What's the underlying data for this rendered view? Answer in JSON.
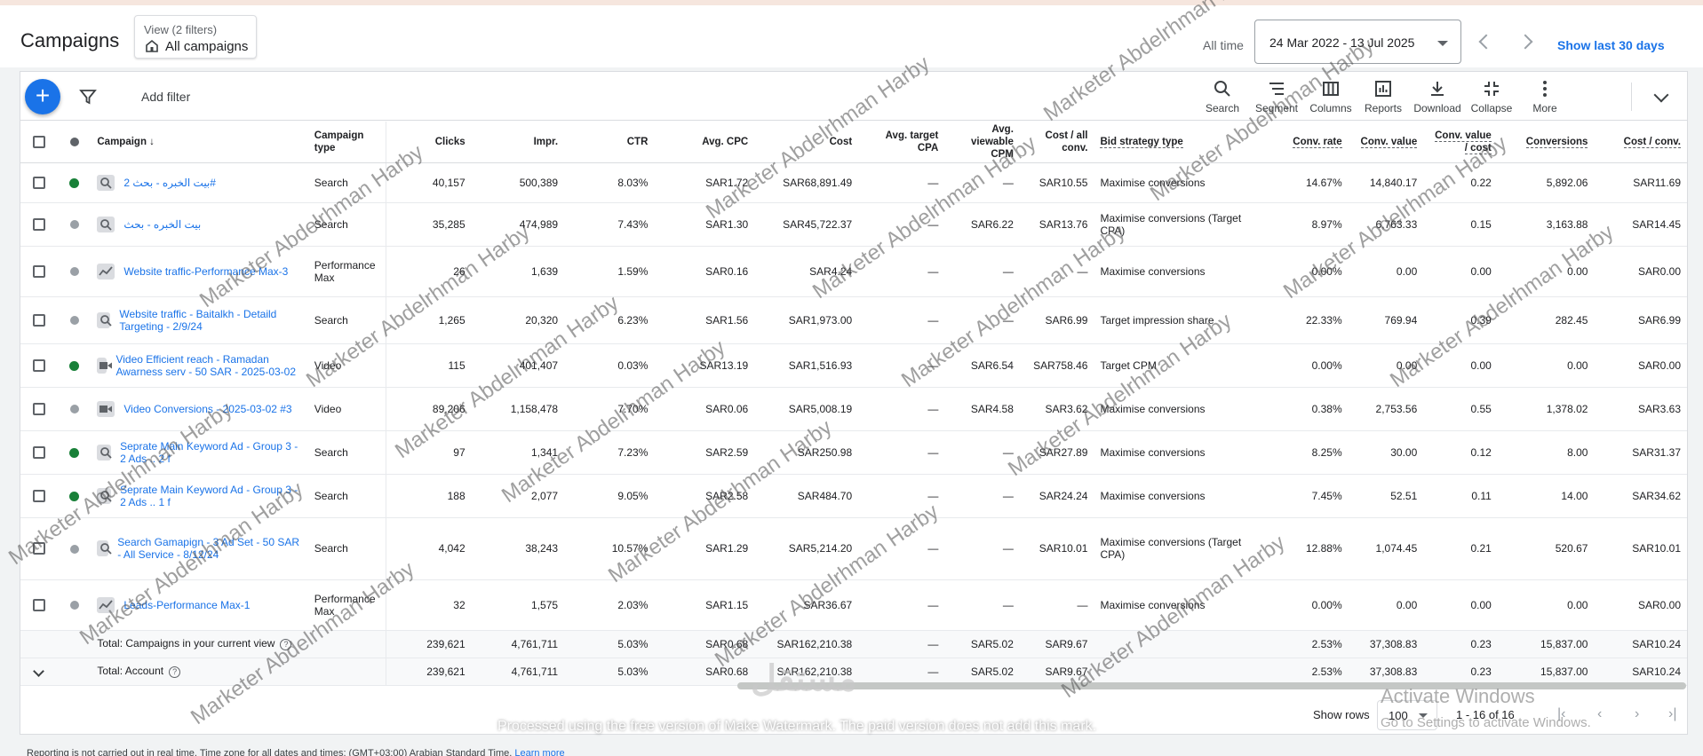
{
  "header": {
    "title": "Campaigns",
    "view_label": "View (2 filters)",
    "view_value": "All campaigns",
    "all_time": "All time",
    "date_range": "24 Mar 2022 - 13 Jul 2025",
    "show_last": "Show last 30 days"
  },
  "toolbar": {
    "add_filter": "Add filter",
    "tools": [
      "Search",
      "Segment",
      "Columns",
      "Reports",
      "Download",
      "Collapse",
      "More"
    ]
  },
  "columns": {
    "campaign": "Campaign",
    "campaign_type": "Campaign type",
    "clicks": "Clicks",
    "impr": "Impr.",
    "ctr": "CTR",
    "avg_cpc": "Avg. CPC",
    "cost": "Cost",
    "avg_target_cpa": "Avg. target CPA",
    "avg_vcpm": "Avg. viewable CPM",
    "cost_conv": "Cost / all conv.",
    "bid": "Bid strategy type",
    "conv_rate": "Conv. rate",
    "conv_value": "Conv. value",
    "conv_value_cost": "Conv. value / cost",
    "conversions": "Conversions",
    "cost_per_conv": "Cost / conv."
  },
  "rows": [
    {
      "status": "enabled",
      "icon": "search",
      "name": "بيت الخبره - بحث 2#",
      "type": "Search",
      "clicks": "40,157",
      "impr": "500,389",
      "ctr": "8.03%",
      "cpc": "SAR1.72",
      "cost": "SAR68,891.49",
      "tcpa": "—",
      "vcpm": "—",
      "costall": "SAR10.55",
      "bid": "Maximise conversions",
      "bid_link": true,
      "crate": "14.67%",
      "cval": "14,840.17",
      "cvc": "0.22",
      "conv": "5,892.06",
      "cpc2": "SAR11.69"
    },
    {
      "status": "paused",
      "icon": "search",
      "name": "بيت الخبره - بحث",
      "type": "Search",
      "clicks": "35,285",
      "impr": "474,989",
      "ctr": "7.43%",
      "cpc": "SAR1.30",
      "cost": "SAR45,722.37",
      "tcpa": "—",
      "vcpm": "SAR6.22",
      "costall": "SAR13.76",
      "bid": "Maximise conversions (Target CPA)",
      "bid_link": true,
      "crate": "8.97%",
      "cval": "6,763.33",
      "cvc": "0.15",
      "conv": "3,163.88",
      "cpc2": "SAR14.45"
    },
    {
      "status": "paused",
      "icon": "pmax",
      "name": "Website traffic-Performance Max-3",
      "type": "Performance Max",
      "clicks": "26",
      "impr": "1,639",
      "ctr": "1.59%",
      "cpc": "SAR0.16",
      "cost": "SAR4.24",
      "tcpa": "—",
      "vcpm": "—",
      "costall": "—",
      "bid": "Maximise conversions",
      "bid_link": true,
      "crate": "0.00%",
      "cval": "0.00",
      "cvc": "0.00",
      "conv": "0.00",
      "cpc2": "SAR0.00"
    },
    {
      "status": "paused",
      "icon": "search",
      "name": "Website traffic - Baitalkh - Detaild Targeting - 2/9/24",
      "type": "Search",
      "clicks": "1,265",
      "impr": "20,320",
      "ctr": "6.23%",
      "cpc": "SAR1.56",
      "cost": "SAR1,973.00",
      "tcpa": "—",
      "vcpm": "—",
      "costall": "SAR6.99",
      "bid": "Target impression share",
      "bid_link": true,
      "crate": "22.33%",
      "cval": "769.94",
      "cvc": "0.39",
      "conv": "282.45",
      "cpc2": "SAR6.99"
    },
    {
      "status": "enabled",
      "icon": "video",
      "name": "Video Efficient reach - Ramadan Awarness serv - 50 SAR - 2025-03-02",
      "type": "Video",
      "clicks": "115",
      "impr": "401,407",
      "ctr": "0.03%",
      "cpc": "SAR13.19",
      "cost": "SAR1,516.93",
      "tcpa": "—",
      "vcpm": "SAR6.54",
      "costall": "SAR758.46",
      "bid": "Target CPM",
      "bid_link": false,
      "crate": "0.00%",
      "cval": "0.00",
      "cvc": "0.00",
      "conv": "0.00",
      "cpc2": "SAR0.00"
    },
    {
      "status": "paused",
      "icon": "video",
      "name": "Video Conversions - 2025-03-02 #3",
      "type": "Video",
      "clicks": "89,206",
      "impr": "1,158,478",
      "ctr": "7.70%",
      "cpc": "SAR0.06",
      "cost": "SAR5,008.19",
      "tcpa": "—",
      "vcpm": "SAR4.58",
      "costall": "SAR3.62",
      "bid": "Maximise conversions",
      "bid_link": true,
      "crate": "0.38%",
      "cval": "2,753.56",
      "cvc": "0.55",
      "conv": "1,378.02",
      "cpc2": "SAR3.63"
    },
    {
      "status": "enabled",
      "icon": "search",
      "name": "Seprate Main Keyword Ad - Group 3 - 2 Ads .. 2 f",
      "type": "Search",
      "clicks": "97",
      "impr": "1,341",
      "ctr": "7.23%",
      "cpc": "SAR2.59",
      "cost": "SAR250.98",
      "tcpa": "—",
      "vcpm": "—",
      "costall": "SAR27.89",
      "bid": "Maximise conversions",
      "bid_link": true,
      "crate": "8.25%",
      "cval": "30.00",
      "cvc": "0.12",
      "conv": "8.00",
      "cpc2": "SAR31.37"
    },
    {
      "status": "enabled",
      "icon": "search",
      "name": "Seprate Main Keyword Ad - Group 3 - 2 Ads .. 1 f",
      "type": "Search",
      "clicks": "188",
      "impr": "2,077",
      "ctr": "9.05%",
      "cpc": "SAR2.58",
      "cost": "SAR484.70",
      "tcpa": "—",
      "vcpm": "—",
      "costall": "SAR24.24",
      "bid": "Maximise conversions",
      "bid_link": true,
      "crate": "7.45%",
      "cval": "52.51",
      "cvc": "0.11",
      "conv": "14.00",
      "cpc2": "SAR34.62"
    },
    {
      "status": "paused",
      "icon": "search",
      "name": "Search Gamapign - 3 Ad Set - 50 SAR - All Service - 8/12/24",
      "type": "Search",
      "clicks": "4,042",
      "impr": "38,243",
      "ctr": "10.57%",
      "cpc": "SAR1.29",
      "cost": "SAR5,214.20",
      "tcpa": "—",
      "vcpm": "—",
      "costall": "SAR10.01",
      "bid": "Maximise conversions (Target CPA)",
      "bid_link": true,
      "crate": "12.88%",
      "cval": "1,074.45",
      "cvc": "0.21",
      "conv": "520.67",
      "cpc2": "SAR10.01"
    },
    {
      "status": "paused",
      "icon": "pmax",
      "name": "Leads-Performance Max-1",
      "type": "Performance Max",
      "clicks": "32",
      "impr": "1,575",
      "ctr": "2.03%",
      "cpc": "SAR1.15",
      "cost": "SAR36.67",
      "tcpa": "—",
      "vcpm": "—",
      "costall": "—",
      "bid": "Maximise conversions",
      "bid_link": true,
      "crate": "0.00%",
      "cval": "0.00",
      "cvc": "0.00",
      "conv": "0.00",
      "cpc2": "SAR0.00"
    }
  ],
  "totals": [
    {
      "label": "Total: Campaigns in your current view",
      "clicks": "239,621",
      "impr": "4,761,711",
      "ctr": "5.03%",
      "cpc": "SAR0.68",
      "cost": "SAR162,210.38",
      "tcpa": "—",
      "vcpm": "SAR5.02",
      "costall": "SAR9.67",
      "crate": "2.53%",
      "cval": "37,308.83",
      "cvc": "0.23",
      "conv": "15,837.00",
      "cpc2": "SAR10.24"
    },
    {
      "label": "Total: Account",
      "clicks": "239,621",
      "impr": "4,761,711",
      "ctr": "5.03%",
      "cpc": "SAR0.68",
      "cost": "SAR162,210.38",
      "tcpa": "—",
      "vcpm": "SAR5.02",
      "costall": "SAR9.67",
      "crate": "2.53%",
      "cval": "37,308.83",
      "cvc": "0.23",
      "conv": "15,837.00",
      "cpc2": "SAR10.24"
    }
  ],
  "pagination": {
    "show_rows": "Show rows",
    "rows_value": "100",
    "range": "1 - 16 of 16"
  },
  "footer": {
    "note": "Reporting is not carried out in real time. Time zone for all dates and times: (GMT+03:00) Arabian Standard Time.",
    "learn_more": "Learn more"
  },
  "overlays": {
    "watermark": "Marketer Abdelrhman Harby",
    "processed": "Processed using the free version of Make Watermark. The paid version does not add this mark.",
    "logo": "مستقل",
    "activate_title": "Activate Windows",
    "activate_sub": "Go to Settings to activate Windows."
  },
  "colors": {
    "accent": "#1a73e8",
    "enabled": "#188038",
    "paused": "#9aa0a6"
  }
}
